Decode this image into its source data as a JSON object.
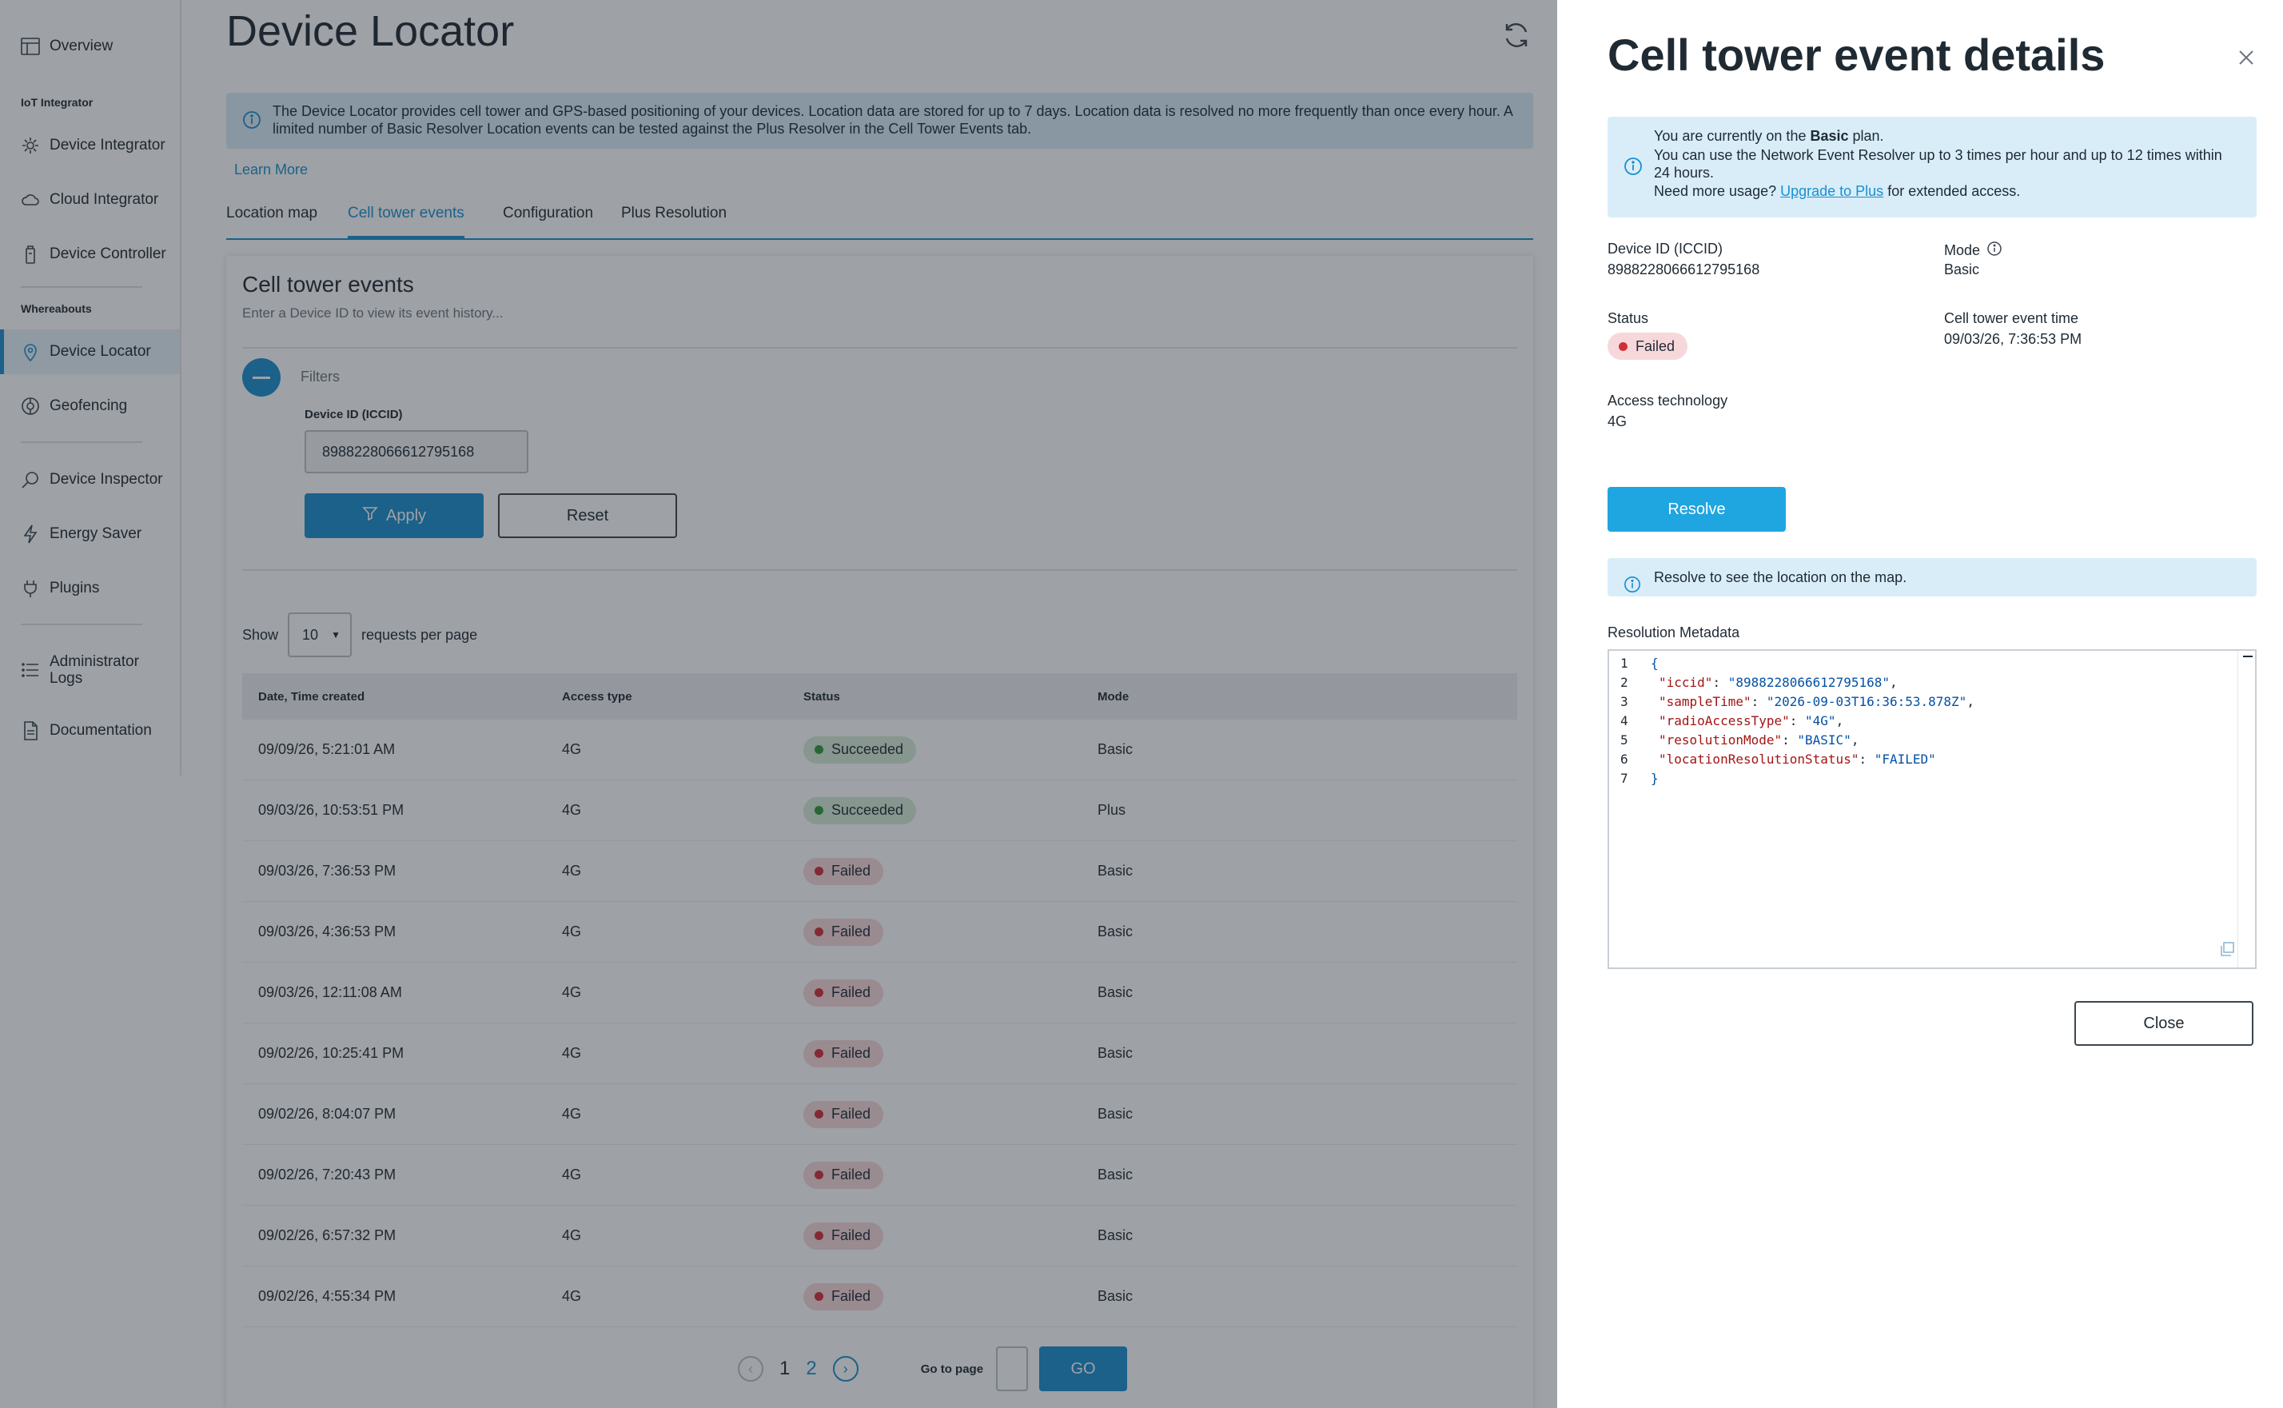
{
  "sidebar": {
    "items": [
      {
        "label": "Overview",
        "icon": "layout-icon"
      },
      {
        "label": "Device Integrator",
        "icon": "device-integrator-icon"
      },
      {
        "label": "Cloud Integrator",
        "icon": "cloud-icon"
      },
      {
        "label": "Device Controller",
        "icon": "controller-icon"
      },
      {
        "label": "Device Locator",
        "icon": "location-pin-icon"
      },
      {
        "label": "Geofencing",
        "icon": "geofence-icon"
      },
      {
        "label": "Device Inspector",
        "icon": "inspector-icon"
      },
      {
        "label": "Energy Saver",
        "icon": "lightning-icon"
      },
      {
        "label": "Plugins",
        "icon": "plug-icon"
      },
      {
        "label": "Administrator Logs",
        "icon": "list-icon"
      },
      {
        "label": "Documentation",
        "icon": "document-icon"
      }
    ],
    "sections": {
      "iot": "IoT Integrator",
      "whereabouts": "Whereabouts"
    },
    "active_item": "Device Locator",
    "accent_color": "#1a8fd0"
  },
  "page": {
    "title": "Device Locator",
    "info_banner": "The Device Locator provides cell tower and GPS-based positioning of your devices. Location data are stored for up to 7 days. Location data is resolved no more frequently than once every hour. A limited number of Basic Resolver Location events can be tested against the Plus Resolver in the Cell Tower Events tab.",
    "learn_more": "Learn More",
    "tabs": [
      "Location map",
      "Cell tower events",
      "Configuration",
      "Plus Resolution"
    ],
    "active_tab": "Cell tower events"
  },
  "events_card": {
    "title": "Cell tower events",
    "subtitle": "Enter a Device ID to view its event history...",
    "filters_label": "Filters",
    "device_id_label": "Device ID (ICCID)",
    "device_id_value": "8988228066612795168",
    "apply_label": "Apply",
    "reset_label": "Reset",
    "show_label": "Show",
    "per_page_value": "10",
    "per_page_suffix": "requests per page",
    "columns": [
      "Date, Time created",
      "Access type",
      "Status",
      "Mode"
    ],
    "rows": [
      {
        "date": "09/09/26, 5:21:01 AM",
        "access": "4G",
        "status": "Succeeded",
        "mode": "Basic"
      },
      {
        "date": "09/03/26, 10:53:51 PM",
        "access": "4G",
        "status": "Succeeded",
        "mode": "Plus"
      },
      {
        "date": "09/03/26, 7:36:53 PM",
        "access": "4G",
        "status": "Failed",
        "mode": "Basic"
      },
      {
        "date": "09/03/26, 4:36:53 PM",
        "access": "4G",
        "status": "Failed",
        "mode": "Basic"
      },
      {
        "date": "09/03/26, 12:11:08 AM",
        "access": "4G",
        "status": "Failed",
        "mode": "Basic"
      },
      {
        "date": "09/02/26, 10:25:41 PM",
        "access": "4G",
        "status": "Failed",
        "mode": "Basic"
      },
      {
        "date": "09/02/26, 8:04:07 PM",
        "access": "4G",
        "status": "Failed",
        "mode": "Basic"
      },
      {
        "date": "09/02/26, 7:20:43 PM",
        "access": "4G",
        "status": "Failed",
        "mode": "Basic"
      },
      {
        "date": "09/02/26, 6:57:32 PM",
        "access": "4G",
        "status": "Failed",
        "mode": "Basic"
      },
      {
        "date": "09/02/26, 4:55:34 PM",
        "access": "4G",
        "status": "Failed",
        "mode": "Basic"
      }
    ],
    "pagination": {
      "current": "1",
      "next": "2",
      "goto_label": "Go to page",
      "go_label": "GO"
    }
  },
  "drawer": {
    "title": "Cell tower event details",
    "info": {
      "line1_prefix": "You are currently on the ",
      "plan": "Basic",
      "line1_suffix": " plan.",
      "line2": "You can use the Network Event Resolver up to 3 times per hour and up to 12 times within 24 hours.",
      "line3_prefix": "Need more usage? ",
      "upgrade_link": "Upgrade to Plus",
      "line3_suffix": " for extended access."
    },
    "device_id_label": "Device ID (ICCID)",
    "device_id_value": "8988228066612795168",
    "mode_label": "Mode",
    "mode_value": "Basic",
    "status_label": "Status",
    "status_value": "Failed",
    "event_time_label": "Cell tower event time",
    "event_time_value": "09/03/26, 7:36:53 PM",
    "access_label": "Access technology",
    "access_value": "4G",
    "resolve_label": "Resolve",
    "hint": "Resolve to see the location on the map.",
    "metadata_label": "Resolution Metadata",
    "metadata_lines": [
      {
        "n": "1",
        "key": "",
        "val": "",
        "text": "{"
      },
      {
        "n": "2",
        "key": "\"iccid\"",
        "val": "\"8988228066612795168\"",
        "text": ","
      },
      {
        "n": "3",
        "key": "\"sampleTime\"",
        "val": "\"2026-09-03T16:36:53.878Z\"",
        "text": ","
      },
      {
        "n": "4",
        "key": "\"radioAccessType\"",
        "val": "\"4G\"",
        "text": ","
      },
      {
        "n": "5",
        "key": "\"resolutionMode\"",
        "val": "\"BASIC\"",
        "text": ","
      },
      {
        "n": "6",
        "key": "\"locationResolutionStatus\"",
        "val": "\"FAILED\"",
        "text": ""
      },
      {
        "n": "7",
        "key": "",
        "val": "",
        "text": "}"
      }
    ],
    "close_label": "Close",
    "resolve_color": "#1fa5e0",
    "fail_color": "#d22e3b",
    "success_color": "#2f9a3c"
  }
}
